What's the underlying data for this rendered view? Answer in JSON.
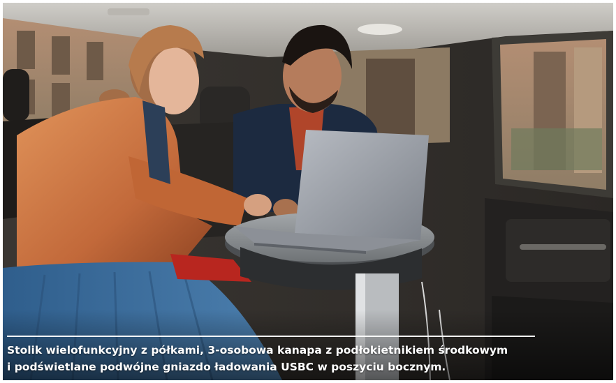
{
  "caption": {
    "line1": "Stolik wielofunkcyjny z półkami, 3-osobowa kanapa z podłokietnikiem środkowym",
    "line2": "i podświetlane podwójne gniazdo ładowania USBC w poszyciu bocznym."
  },
  "colors": {
    "caption_text": "#ffffff",
    "caption_rule": "#ffffff",
    "jacket": "#c8733e",
    "skirt": "#3f6f9c",
    "laptop": "#9a9ea6",
    "table": "#8f9396"
  }
}
